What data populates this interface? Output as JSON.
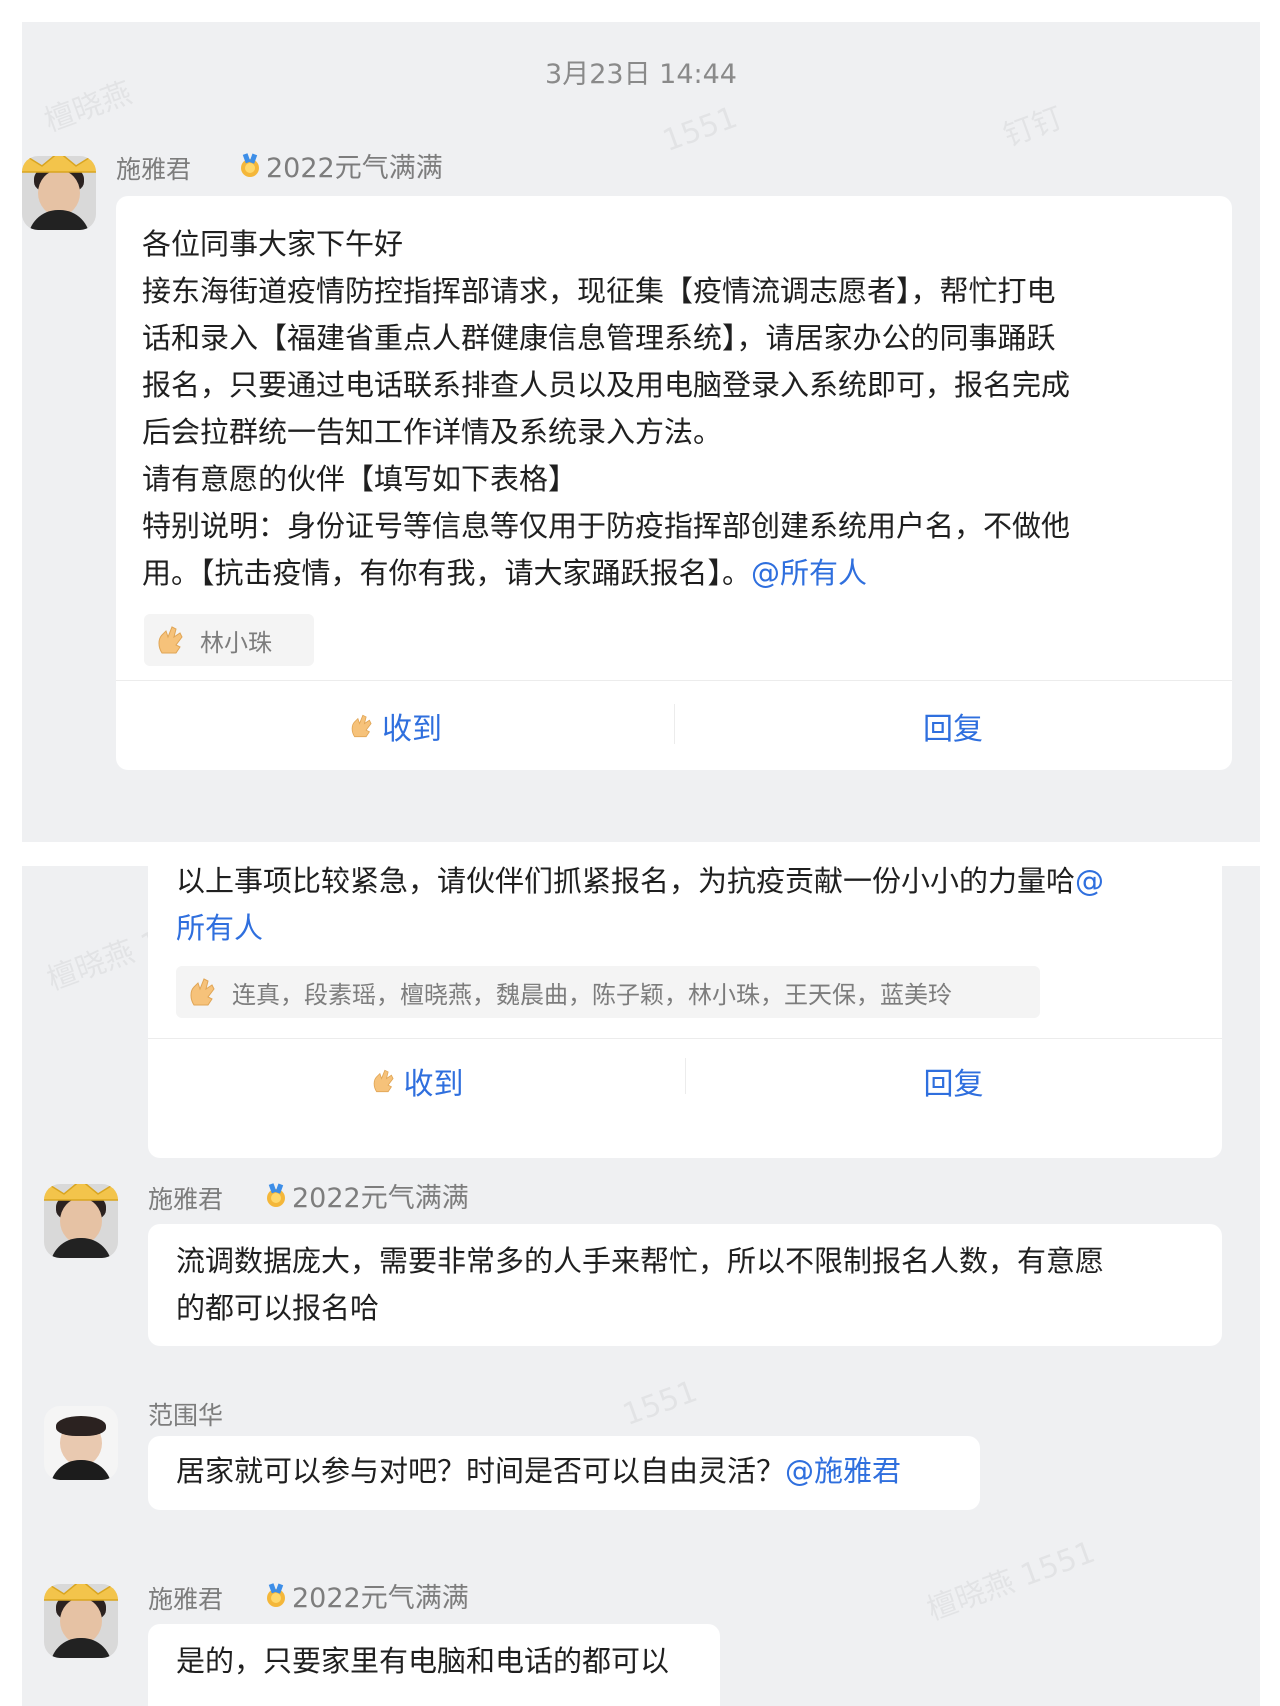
{
  "conversation": {
    "timestamp": "3月23日 14:44",
    "first_message": {
      "sender": "施雅君",
      "badge": "2022元气满满",
      "lines": [
        "各位同事大家下午好",
        "接东海街道疫情防控指挥部请求，现征集【疫情流调志愿者】，帮忙打电",
        "话和录入【福建省重点人群健康信息管理系统】，请居家办公的同事踊跃",
        "报名，只要通过电话联系排查人员以及用电脑登录入系统即可，报名完成",
        "后会拉群统一告知工作详情及系统录入方法。",
        "请有意愿的伙伴【填写如下表格】",
        "特别说明：身份证号等信息等仅用于防疫指挥部创建系统用户名，不做他"
      ],
      "last_line_text": "用。【抗击疫情，有你有我，请大家踊跃报名】。",
      "mention": "@所有人",
      "readers": "林小珠",
      "ack_label": "收到",
      "reply_label": "回复"
    },
    "second_message": {
      "line1_text": "以上事项比较紧急，请伙伴们抓紧报名，为抗疫贡献一份小小的力量哈",
      "line1_mention": "@",
      "line2_mention": "所有人",
      "readers": "连真，段素瑶，檀晓燕，魏晨曲，陈子颖，林小珠，王天保，蓝美玲",
      "ack_label": "收到",
      "reply_label": "回复"
    },
    "third_message": {
      "sender": "施雅君",
      "badge": "2022元气满满",
      "lines": [
        "流调数据庞大，需要非常多的人手来帮忙，所以不限制报名人数，有意愿",
        "的都可以报名哈"
      ]
    },
    "fourth_message": {
      "sender": "范围华",
      "text": "居家就可以参与对吧？时间是否可以自由灵活？",
      "mention": "@施雅君"
    },
    "fifth_message": {
      "sender": "施雅君",
      "badge": "2022元气满满",
      "text": "是的，只要家里有电脑和电话的都可以"
    }
  },
  "colors": {
    "panel_bg": "#eff0f2",
    "bubble_bg": "#ffffff",
    "mention": "#2f6fde",
    "muted_text": "#7d7d7d"
  },
  "icons": {
    "badge": "medal-icon",
    "ack": "hand-ok-icon",
    "avatar_decoration": "crown-icon"
  }
}
